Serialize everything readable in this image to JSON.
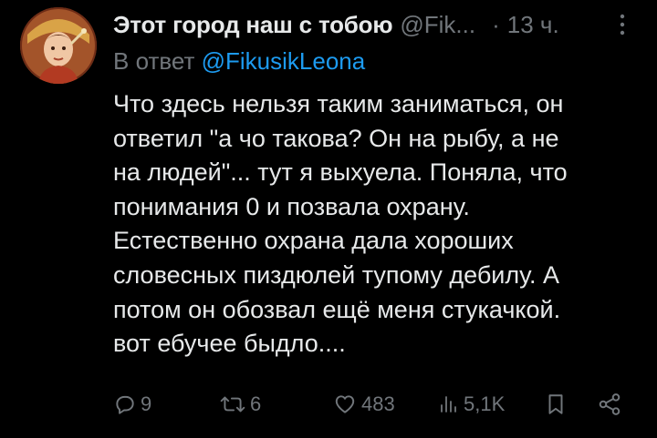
{
  "author": {
    "display_name": "Этот город наш с тобою",
    "handle": "@Fik...",
    "separator": "·",
    "time": "13 ч."
  },
  "reply": {
    "prefix": "В ответ",
    "mention": "@FikusikLeona"
  },
  "body": {
    "lines": [
      "Что здесь нельзя таким заниматься, он",
      "ответил \"а чо такова? Он на рыбу, а не",
      "на людей\"... тут я выхуела. Поняла, что",
      "понимания 0 и позвала охрану.",
      "Естественно охрана дала хороших",
      "словесных пиздюлей тупому дебилу. А",
      "потом он обозвал ещё меня стукачкой.",
      "вот ебучее быдло...."
    ]
  },
  "actions": {
    "replies": "9",
    "retweets": "6",
    "likes": "483",
    "views": "5,1K"
  },
  "icons": {
    "avatar": "avatar-image",
    "more": "more-dots-icon",
    "reply": "reply-bubble-icon",
    "retweet": "retweet-icon",
    "like": "heart-icon",
    "views": "views-bar-icon",
    "bookmark": "bookmark-icon",
    "share": "share-icon"
  },
  "colors": {
    "background": "#000000",
    "text": "#e7e9ea",
    "muted": "#71767b",
    "link": "#1d9bf0"
  }
}
